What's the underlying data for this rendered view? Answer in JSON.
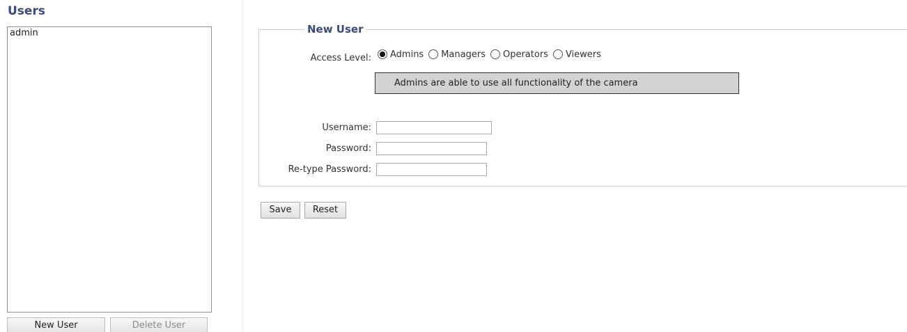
{
  "users_panel": {
    "title": "Users",
    "items": [
      "admin"
    ],
    "new_user_label": "New User",
    "delete_user_label": "Delete User"
  },
  "new_user_form": {
    "legend": "New User",
    "access_level_label": "Access Level:",
    "access_levels": [
      {
        "label": "Admins",
        "selected": true
      },
      {
        "label": "Managers",
        "selected": false
      },
      {
        "label": "Operators",
        "selected": false
      },
      {
        "label": "Viewers",
        "selected": false
      }
    ],
    "access_description": "Admins are able to use all functionality of the camera",
    "username_label": "Username:",
    "username_value": "",
    "password_label": "Password:",
    "password_value": "",
    "retype_label": "Re-type Password:",
    "retype_value": "",
    "save_label": "Save",
    "reset_label": "Reset"
  },
  "colors": {
    "title": "#3b4a7a",
    "info_box_bg": "#d3d3d3",
    "disabled_text": "#8a8a8a"
  }
}
